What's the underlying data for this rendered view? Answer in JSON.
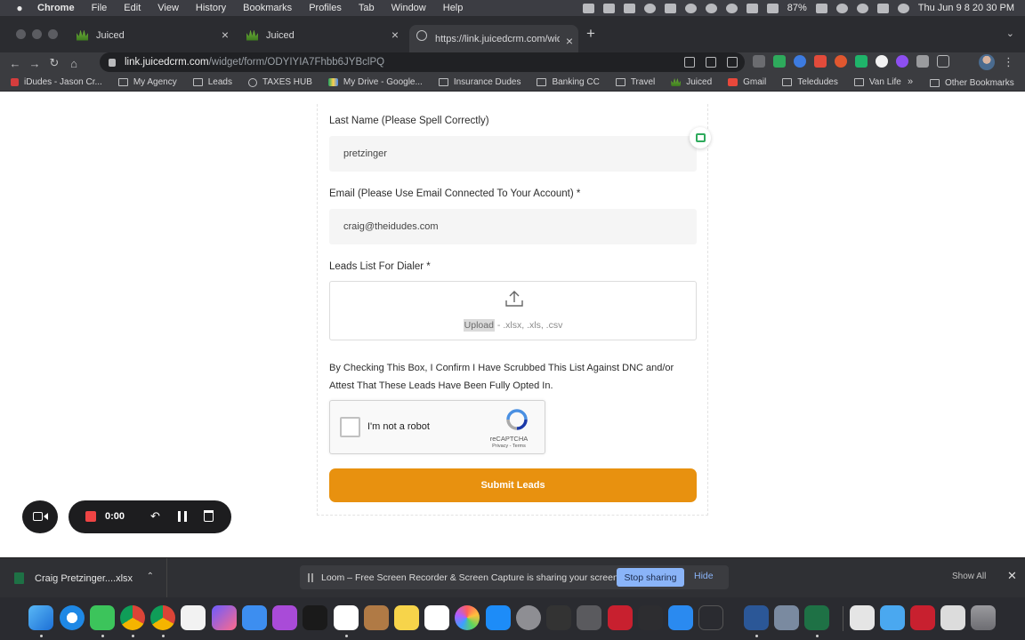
{
  "menubar": {
    "app": "Chrome",
    "menus": [
      "File",
      "Edit",
      "View",
      "History",
      "Bookmarks",
      "Profiles",
      "Tab",
      "Window",
      "Help"
    ],
    "battery": "87%",
    "clock": "Thu Jun 9  8 20 30 PM"
  },
  "tabs": [
    {
      "title": "Juiced",
      "icon": "juiced-logo-icon"
    },
    {
      "title": "Juiced",
      "icon": "juiced-logo-icon"
    },
    {
      "title": "https://link.juicedcrm.com/widg",
      "icon": "globe-icon"
    }
  ],
  "address": {
    "host": "link.juicedcrm.com",
    "path": "/widget/form/ODYIYIA7Fhbb6JYBclPQ"
  },
  "bookmarks": [
    "iDudes - Jason Cr...",
    "My Agency",
    "Leads",
    "TAXES HUB",
    "My Drive - Google...",
    "Insurance Dudes",
    "Banking CC",
    "Travel",
    "Juiced",
    "Gmail",
    "Teledudes",
    "Van Life"
  ],
  "other_bookmarks": "Other Bookmarks",
  "form": {
    "last_name_label": "Last Name (Please Spell Correctly)",
    "last_name_value": "pretzinger",
    "email_label": "Email (Please Use Email Connected To Your Account) *",
    "email_value": "craig@theidudes.com",
    "leads_label": "Leads List For Dialer *",
    "upload_word": "Upload",
    "upload_types": " - .xlsx, .xls, .csv",
    "consent": "By Checking This Box, I Confirm I Have Scrubbed This List Against DNC and/or Attest That These Leads Have Been Fully Opted In.",
    "captcha_label": "I'm not a robot",
    "captcha_brand": "reCAPTCHA",
    "captcha_links": "Privacy - Terms",
    "submit_label": "Submit Leads",
    "accent_color": "#e8910f"
  },
  "loom": {
    "timer": "0:00"
  },
  "downloads": {
    "file": "Craig Pretzinger....xlsx",
    "share_message": "Loom – Free Screen Recorder & Screen Capture is sharing your screen.",
    "stop_label": "Stop sharing",
    "hide_label": "Hide",
    "show_all": "Show All"
  }
}
